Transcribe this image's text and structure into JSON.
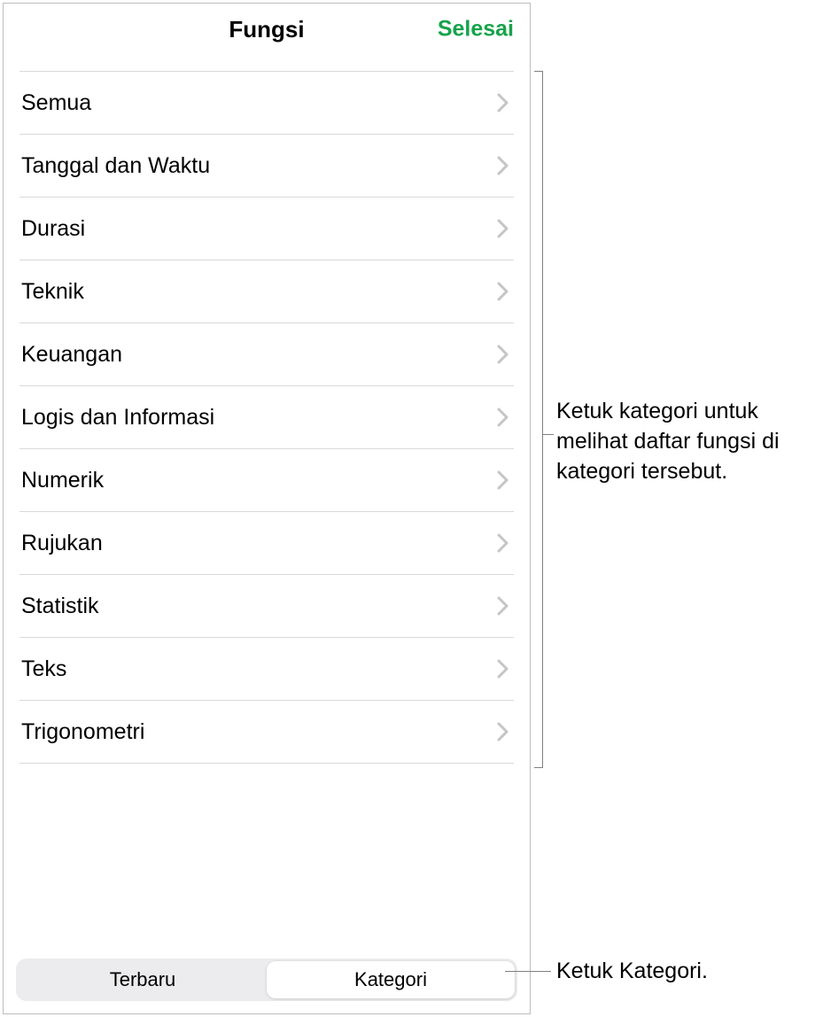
{
  "header": {
    "title": "Fungsi",
    "done": "Selesai"
  },
  "categories": [
    {
      "label": "Semua"
    },
    {
      "label": "Tanggal dan Waktu"
    },
    {
      "label": "Durasi"
    },
    {
      "label": "Teknik"
    },
    {
      "label": "Keuangan"
    },
    {
      "label": "Logis dan Informasi"
    },
    {
      "label": "Numerik"
    },
    {
      "label": "Rujukan"
    },
    {
      "label": "Statistik"
    },
    {
      "label": "Teks"
    },
    {
      "label": "Trigonometri"
    }
  ],
  "segments": {
    "recent": "Terbaru",
    "category": "Kategori"
  },
  "callouts": {
    "list": "Ketuk kategori untuk melihat daftar fungsi di kategori tersebut.",
    "segment": "Ketuk Kategori."
  },
  "colors": {
    "accent": "#16a34a"
  }
}
